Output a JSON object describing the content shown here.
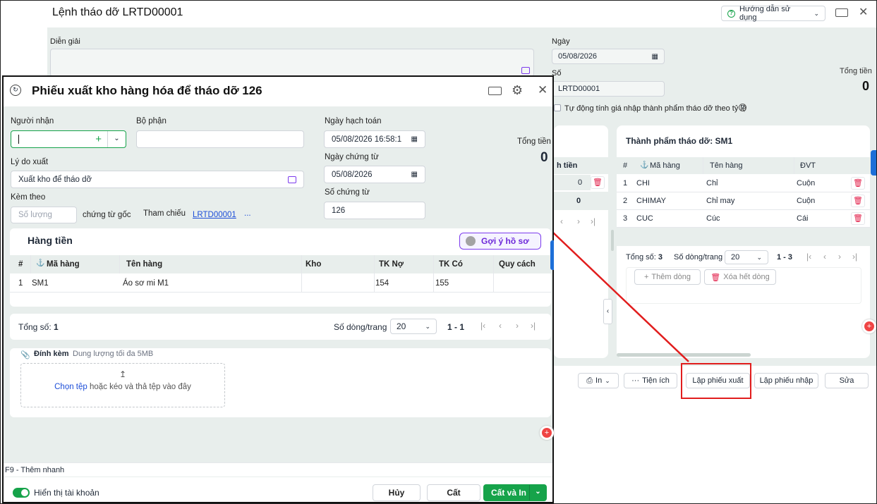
{
  "background_window": {
    "title": "Lệnh tháo dỡ LRTD00001",
    "help_label": "Hướng dẫn sử dụng",
    "description_label": "Diễn giải",
    "date_label": "Ngày",
    "date_value": "05/08/2026",
    "number_label": "Số",
    "number_value": "LRTD00001",
    "total_label": "Tổng tiền",
    "total_value": "0",
    "auto_price_label": "Tự động tính giá nhập thành phẩm tháo dỡ theo tỷ lệ",
    "left_table": {
      "header_fragment": "h tiền",
      "row_value": "0",
      "total_value": "0"
    },
    "product_table": {
      "title": "Thành phẩm tháo dỡ: SM1",
      "columns": [
        "#",
        "Mã hàng",
        "Tên hàng",
        "ĐVT"
      ],
      "rows": [
        {
          "idx": "1",
          "code": "CHI",
          "name": "Chỉ",
          "unit": "Cuộn"
        },
        {
          "idx": "2",
          "code": "CHIMAY",
          "name": "Chỉ may",
          "unit": "Cuộn"
        },
        {
          "idx": "3",
          "code": "CUC",
          "name": "Cúc",
          "unit": "Cái"
        }
      ],
      "total_label": "Tổng số:",
      "total_count": "3",
      "rows_per_page_label": "Số dòng/trang",
      "rows_per_page": "20",
      "range": "1 - 3",
      "add_row": "Thêm dòng",
      "delete_all": "Xóa hết dòng"
    },
    "footer": {
      "print": "In",
      "utilities": "Tiện ích",
      "export_slip": "Lập phiếu xuất",
      "import_slip": "Lập phiếu nhập",
      "edit": "Sửa"
    }
  },
  "dialog": {
    "title": "Phiếu xuất kho hàng hóa để tháo dỡ 126",
    "recipient_label": "Người nhận",
    "department_label": "Bộ phận",
    "reason_label": "Lý do xuất",
    "reason_value": "Xuất kho để tháo dỡ",
    "attach_label": "Kèm theo",
    "qty_placeholder": "Số lượng",
    "original_docs": "chứng từ gốc",
    "reference_label": "Tham chiếu",
    "reference_value": "LRTD00001",
    "reference_more": "...",
    "posting_date_label": "Ngày hạch toán",
    "posting_date_value": "05/08/2026 16:58:1",
    "doc_date_label": "Ngày chứng từ",
    "doc_date_value": "05/08/2026",
    "doc_no_label": "Số chứng từ",
    "doc_no_value": "126",
    "total_label": "Tổng tiền",
    "total_value": "0",
    "goods_tab": "Hàng tiền",
    "suggest_label": "Gợi ý hồ sơ",
    "columns": [
      "#",
      "Mã hàng",
      "Tên hàng",
      "Kho",
      "TK Nợ",
      "TK Có",
      "Quy cách"
    ],
    "rows": [
      {
        "idx": "1",
        "code": "SM1",
        "name": "Áo sơ mi M1",
        "warehouse": "",
        "debit": "154",
        "credit": "155",
        "spec": ""
      }
    ],
    "total_count_label": "Tổng số:",
    "total_count": "1",
    "rows_per_page_label": "Số dòng/trang",
    "rows_per_page": "20",
    "range": "1 - 1",
    "attachment_label": "Đính kèm",
    "attachment_limit": "Dung lượng tối đa 5MB",
    "choose_file": "Chọn tệp",
    "drop_text": "hoặc kéo và thả tệp vào đây",
    "shortcut_hint": "F9 - Thêm nhanh",
    "show_accounts": "Hiển thị tài khoản",
    "cancel": "Hủy",
    "save": "Cất",
    "save_print": "Cất và In"
  },
  "colors": {
    "accent_green": "#16a34a",
    "highlight_red": "#e11d1d",
    "link_blue": "#1d4ed8"
  }
}
